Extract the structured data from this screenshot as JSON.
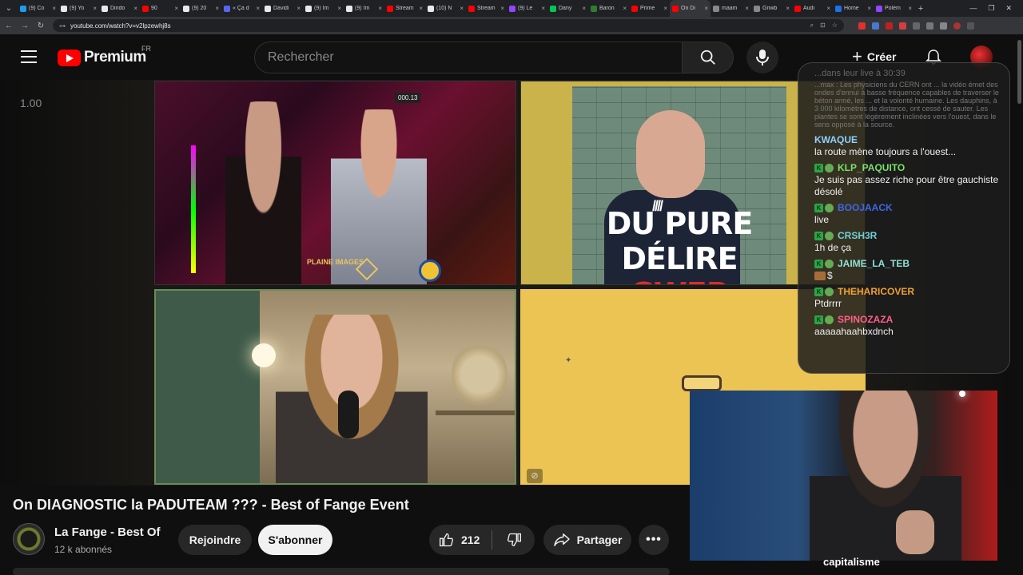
{
  "browser": {
    "tabs": [
      {
        "title": "(9) Co",
        "color": "#1d9bf0"
      },
      {
        "title": "(9) Yo",
        "color": "#e7e9ea"
      },
      {
        "title": "Dindo",
        "color": "#e7e9ea"
      },
      {
        "title": "90",
        "color": "#ff0000"
      },
      {
        "title": "(9) 20",
        "color": "#e7e9ea"
      },
      {
        "title": "« Ça d",
        "color": "#5865f2"
      },
      {
        "title": "Davidi",
        "color": "#e7e9ea"
      },
      {
        "title": "(9) Im",
        "color": "#e7e9ea"
      },
      {
        "title": "(9) Im",
        "color": "#e7e9ea"
      },
      {
        "title": "Stream",
        "color": "#ff0000"
      },
      {
        "title": "(10) N",
        "color": "#e7e9ea"
      },
      {
        "title": "Stream",
        "color": "#ff0000"
      },
      {
        "title": "(9) Le",
        "color": "#9146ff"
      },
      {
        "title": "Dany",
        "color": "#00c853"
      },
      {
        "title": "Baron",
        "color": "#2e7d32"
      },
      {
        "title": "Prime",
        "color": "#ff0000"
      },
      {
        "title": "On Di",
        "color": "#ff0000",
        "active": true
      },
      {
        "title": "maam",
        "color": "#888888"
      },
      {
        "title": "Gnwb",
        "color": "#888888"
      },
      {
        "title": "Audi",
        "color": "#ff0000"
      },
      {
        "title": "Home",
        "color": "#1a73e8"
      },
      {
        "title": "Polém",
        "color": "#9146ff"
      }
    ],
    "url": "youtube.com/watch?v=v2lpzewhj8s"
  },
  "header": {
    "brand": "Premium",
    "region": "FR",
    "search_placeholder": "Rechercher",
    "create_label": "Créer"
  },
  "player": {
    "speed": "1.00",
    "cell1_sign": "PLAINE IMAGES",
    "cell1_topsign": "000.13",
    "cell2_caption_line1": "DU PURE",
    "cell2_caption_line2_white": "DÉLIRE ",
    "cell2_caption_line2_red": "GWER",
    "cell2_slashes": "////"
  },
  "chat": {
    "header_faded": "...dans leur live à 30:39",
    "faded_text": "...max : Les physiciens du CERN ont ... la vidéo émet des ondes d'ennui à basse fréquence capables de traverser le béton armé, les ... et la volonté humaine. Les dauphins, à 3 000 kilomètres de distance, ont cessé de sauter. Les plantes se sont légèrement inclinées vers l'ouest, dans le sens opposé à la source.",
    "messages": [
      {
        "user": "KWAQUE",
        "color": "#8fd0ff",
        "badges": false,
        "text": "la route mène toujours a l'ouest..."
      },
      {
        "user": "KLP_PAQUITO",
        "color": "#7ce06b",
        "badges": true,
        "text": "Je suis pas assez riche pour être gauchiste désolé"
      },
      {
        "user": "BOOJAACK",
        "color": "#3f67e6",
        "badges": true,
        "text": "live"
      },
      {
        "user": "CRSH3R",
        "color": "#6fd1d6",
        "badges": true,
        "text": "1h de ça"
      },
      {
        "user": "JAIME_LA_TEB",
        "color": "#8fe0d2",
        "badges": true,
        "text": "$",
        "emote_img": true
      },
      {
        "user": "THEHARICOVER",
        "color": "#f0a030",
        "badges": true,
        "text": "Ptdrrrr"
      },
      {
        "user": "SPINOZAZA",
        "color": "#ff5f8a",
        "badges": true,
        "text": "aaaaahaahbxdnch"
      }
    ]
  },
  "facecam": {
    "caption": "capitalisme"
  },
  "video": {
    "title": "On DIAGNOSTIC la PADUTEAM ??? - Best of Fange Event",
    "channel": "La Fange - Best Of",
    "subscribers": "12 k abonnés",
    "join_label": "Rejoindre",
    "subscribe_label": "S'abonner",
    "likes": "212",
    "share_label": "Partager",
    "more_label": "•••"
  }
}
